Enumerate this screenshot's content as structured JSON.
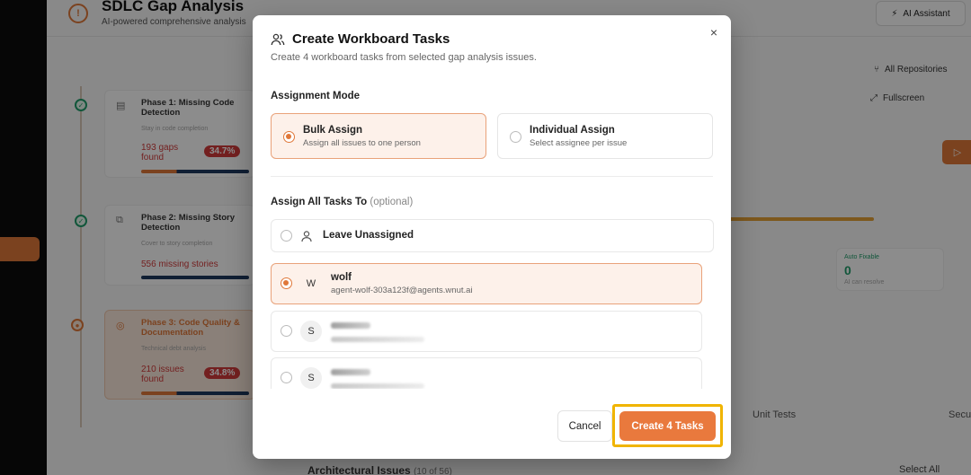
{
  "app": {
    "title": "SDLC Gap Analysis",
    "subtitle": "AI-powered comprehensive analysis",
    "ai_button": "AI Assistant",
    "all_repositories": "All Repositories",
    "fullscreen": "Fullscreen",
    "phases": [
      {
        "title": "Phase 1: Missing Code Detection",
        "subtitle": "Stay in code completion",
        "count": "193 gaps found",
        "percent": "34.7%"
      },
      {
        "title": "Phase 2: Missing Story Detection",
        "subtitle": "Cover to story completion",
        "count": "556 missing stories"
      },
      {
        "title": "Phase 3: Code Quality & Documentation",
        "subtitle": "Technical debt analysis",
        "count": "210 issues found",
        "percent": "34.8%"
      }
    ],
    "stat_label": "Auto Fixable",
    "stat_value": "0",
    "stat_sub": "AI can resolve",
    "tabs": [
      "Unit Tests",
      "Secu"
    ],
    "section_title": "Architectural Issues",
    "section_count": "(10 of 56)",
    "select_all": "Select All"
  },
  "modal": {
    "title": "Create Workboard Tasks",
    "subtitle": "Create 4 workboard tasks from selected gap analysis issues.",
    "close": "×",
    "assignment_mode_label": "Assignment Mode",
    "modes": [
      {
        "title": "Bulk Assign",
        "desc": "Assign all issues to one person",
        "selected": true
      },
      {
        "title": "Individual Assign",
        "desc": "Select assignee per issue",
        "selected": false
      }
    ],
    "assign_label": "Assign All Tasks To",
    "assign_optional": "(optional)",
    "unassigned_label": "Leave Unassigned",
    "assignees": [
      {
        "initial": "W",
        "name": "wolf",
        "email": "agent-wolf-303a123f@agents.wnut.ai",
        "selected": true
      },
      {
        "initial": "S",
        "name": "",
        "email": "",
        "selected": false
      },
      {
        "initial": "S",
        "name": "",
        "email": "",
        "selected": false
      }
    ],
    "cancel": "Cancel",
    "create": "Create 4 Tasks"
  },
  "colors": {
    "accent": "#e9793d",
    "selected_bg": "#fdf1ea",
    "highlight": "#f0b400"
  }
}
